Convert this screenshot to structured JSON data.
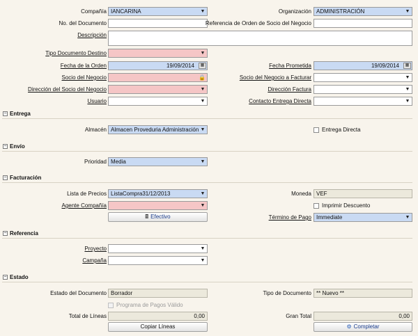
{
  "header": {
    "compania": {
      "label": "Compañía",
      "value": "IANCARINA"
    },
    "organizacion": {
      "label": "Organización",
      "value": "ADMINISTRACIÓN"
    },
    "no_documento": {
      "label": "No. del Documento",
      "value": ""
    },
    "referencia_orden": {
      "label": "Referencia de Orden de Socio del Negocio",
      "value": ""
    },
    "descripcion": {
      "label": "Descripción",
      "value": ""
    },
    "tipo_documento_destino": {
      "label": "Tipo Documento Destino",
      "value": ""
    },
    "fecha_orden": {
      "label": "Fecha de la Orden",
      "value": "19/09/2014"
    },
    "fecha_prometida": {
      "label": "Fecha Prometida",
      "value": "19/09/2014"
    },
    "socio_negocio": {
      "label": "Socio del Negocio",
      "value": ""
    },
    "socio_facturar": {
      "label": "Socio del Negocio a Facturar",
      "value": ""
    },
    "direccion_socio": {
      "label": "Dirección del Socio del Negocio",
      "value": ""
    },
    "direccion_factura": {
      "label": "Dirección Factura",
      "value": ""
    },
    "usuario": {
      "label": "Usuario",
      "value": ""
    },
    "contacto_entrega": {
      "label": "Contacto Entrega Directa",
      "value": ""
    }
  },
  "entrega": {
    "title": "Entrega",
    "almacen": {
      "label": "Almacén",
      "value": "Almacen Proveduria Administración"
    },
    "entrega_directa": {
      "label": "Entrega Directa",
      "checked": false
    }
  },
  "envio": {
    "title": "Envío",
    "prioridad": {
      "label": "Prioridad",
      "value": "Media"
    }
  },
  "facturacion": {
    "title": "Facturación",
    "lista_precios": {
      "label": "Lista de Precios",
      "value": "ListaCompra31/12/2013"
    },
    "moneda": {
      "label": "Moneda",
      "value": "VEF"
    },
    "agente_compania": {
      "label": "Agente Compañía",
      "value": ""
    },
    "imprimir_descuento": {
      "label": "Imprimir Descuento",
      "checked": false
    },
    "efectivo_button": "Efectivo",
    "termino_pago": {
      "label": "Término de Pago",
      "value": "Immediate"
    }
  },
  "referencia": {
    "title": "Referencia",
    "proyecto": {
      "label": "Proyecto",
      "value": ""
    },
    "campana": {
      "label": "Campaña",
      "value": ""
    }
  },
  "estado": {
    "title": "Estado",
    "estado_documento": {
      "label": "Estado del Documento",
      "value": "Borrador"
    },
    "tipo_documento": {
      "label": "Tipo de Documento",
      "value": "** Nuevo **"
    },
    "programa_pagos": {
      "label": "Programa de Pagos Válido",
      "checked": false
    },
    "total_lineas": {
      "label": "Total de Líneas",
      "value": "0,00"
    },
    "gran_total": {
      "label": "Gran Total",
      "value": "0,00"
    },
    "copiar_lineas_button": "Copiar Líneas",
    "completar_button": "Completar"
  }
}
